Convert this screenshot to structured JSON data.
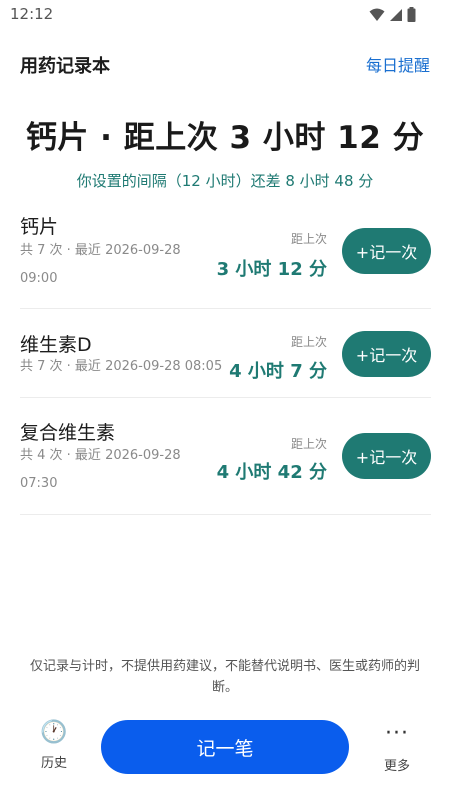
{
  "status_bar": {
    "time": "12:12",
    "icons": [
      "wifi-icon",
      "signal-icon",
      "battery-icon"
    ]
  },
  "header": {
    "title": "用药记录本",
    "reminder_link": "每日提醒"
  },
  "hero": {
    "title": "钙片 · 距上次 3 小时 12 分",
    "subtitle": "你设置的间隔（12 小时）还差 8 小时 48 分"
  },
  "since_label": "距上次",
  "log_button_label": "+记一次",
  "medications": [
    {
      "name": "钙片",
      "meta_line1": "共 7 次 · 最近 2026-09-28",
      "meta_line2": "09:00",
      "since": "3 小时 12 分"
    },
    {
      "name": "维生素D",
      "meta_line1": "共 7 次 · 最近 2026-09-28 08:05",
      "meta_line2": "",
      "since": "4 小时 7 分"
    },
    {
      "name": "复合维生素",
      "meta_line1": "共 4 次 · 最近 2026-09-28",
      "meta_line2": "07:30",
      "since": "4 小时 42 分"
    }
  ],
  "disclaimer": "仅记录与计时，不提供用药建议，不能替代说明书、医生或药师的判断。",
  "bottom_nav": {
    "history_label": "历史",
    "history_icon": "clock-icon",
    "primary_button": "记一笔",
    "more_label": "更多",
    "more_icon": "more-dots-icon"
  },
  "colors": {
    "accent": "#1f7a73",
    "primary": "#0a5ded",
    "link": "#1a6fd0"
  }
}
